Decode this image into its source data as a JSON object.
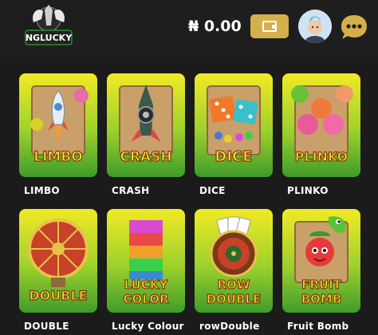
{
  "header": {
    "logo_text": "NGLUCKY",
    "balance": "₦ 0.00",
    "wallet_icon": "wallet-icon",
    "avatar_icon": "user-avatar",
    "chat_icon": "chat-bubble-icon"
  },
  "colors": {
    "background": "#1b1b1b",
    "accent_gold": "#d4b04c",
    "card_green": "#4aa82c",
    "card_yellow": "#e8e02a"
  },
  "games": [
    {
      "title": "LIMBO",
      "thumb_label": "LIMBO"
    },
    {
      "title": "CRASH",
      "thumb_label": "CRASH"
    },
    {
      "title": "DICE",
      "thumb_label": "DICE"
    },
    {
      "title": "PLINKO",
      "thumb_label": "PLINKO"
    },
    {
      "title": "DOUBLE",
      "thumb_label": "DOUBLE"
    },
    {
      "title": "Lucky Colour",
      "thumb_label_line1": "LUCKY",
      "thumb_label_line2": "COLOR"
    },
    {
      "title": "rowDouble",
      "thumb_label_line1": "ROW",
      "thumb_label_line2": "DOUBLE"
    },
    {
      "title": "Fruit Bomb",
      "thumb_label_line1": "FRUIT",
      "thumb_label_line2": "BOMB"
    }
  ]
}
